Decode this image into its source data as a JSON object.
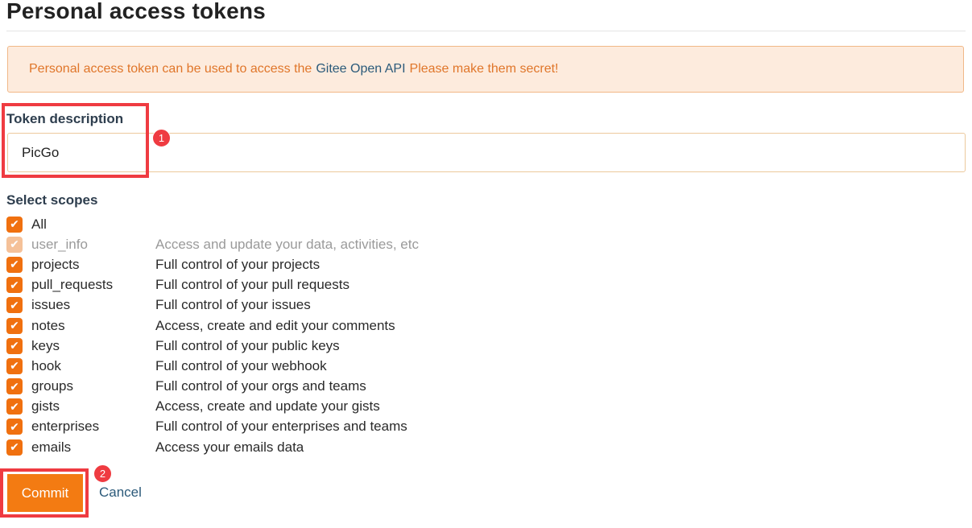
{
  "page": {
    "title": "Personal access tokens"
  },
  "alert": {
    "text_before": "Personal access token can be used to access the",
    "link": "Gitee Open API",
    "text_after": "Please make them secret!"
  },
  "form": {
    "description_label": "Token description",
    "description_value": "PicGo",
    "scopes_label": "Select scopes"
  },
  "scopes": [
    {
      "name": "All",
      "desc": "",
      "checked": true,
      "disabled": false
    },
    {
      "name": "user_info",
      "desc": "Access and update your data, activities, etc",
      "checked": true,
      "disabled": true
    },
    {
      "name": "projects",
      "desc": "Full control of your projects",
      "checked": true,
      "disabled": false
    },
    {
      "name": "pull_requests",
      "desc": "Full control of your pull requests",
      "checked": true,
      "disabled": false
    },
    {
      "name": "issues",
      "desc": "Full control of your issues",
      "checked": true,
      "disabled": false
    },
    {
      "name": "notes",
      "desc": "Access, create and edit your comments",
      "checked": true,
      "disabled": false
    },
    {
      "name": "keys",
      "desc": "Full control of your public keys",
      "checked": true,
      "disabled": false
    },
    {
      "name": "hook",
      "desc": "Full control of your webhook",
      "checked": true,
      "disabled": false
    },
    {
      "name": "groups",
      "desc": "Full control of your orgs and teams",
      "checked": true,
      "disabled": false
    },
    {
      "name": "gists",
      "desc": "Access, create and update your gists",
      "checked": true,
      "disabled": false
    },
    {
      "name": "enterprises",
      "desc": "Full control of your enterprises and teams",
      "checked": true,
      "disabled": false
    },
    {
      "name": "emails",
      "desc": "Access your emails data",
      "checked": true,
      "disabled": false
    }
  ],
  "actions": {
    "commit_label": "Commit",
    "cancel_label": "Cancel"
  },
  "annotations": {
    "badge_1": "1",
    "badge_2": "2"
  },
  "colors": {
    "accent": "#f37b12",
    "highlight": "#ef3b41",
    "alert_bg": "#fdebdd",
    "alert_text": "#e0762a",
    "link": "#2b5a7a"
  },
  "icons": {
    "checkbox": "checkmark-icon"
  }
}
